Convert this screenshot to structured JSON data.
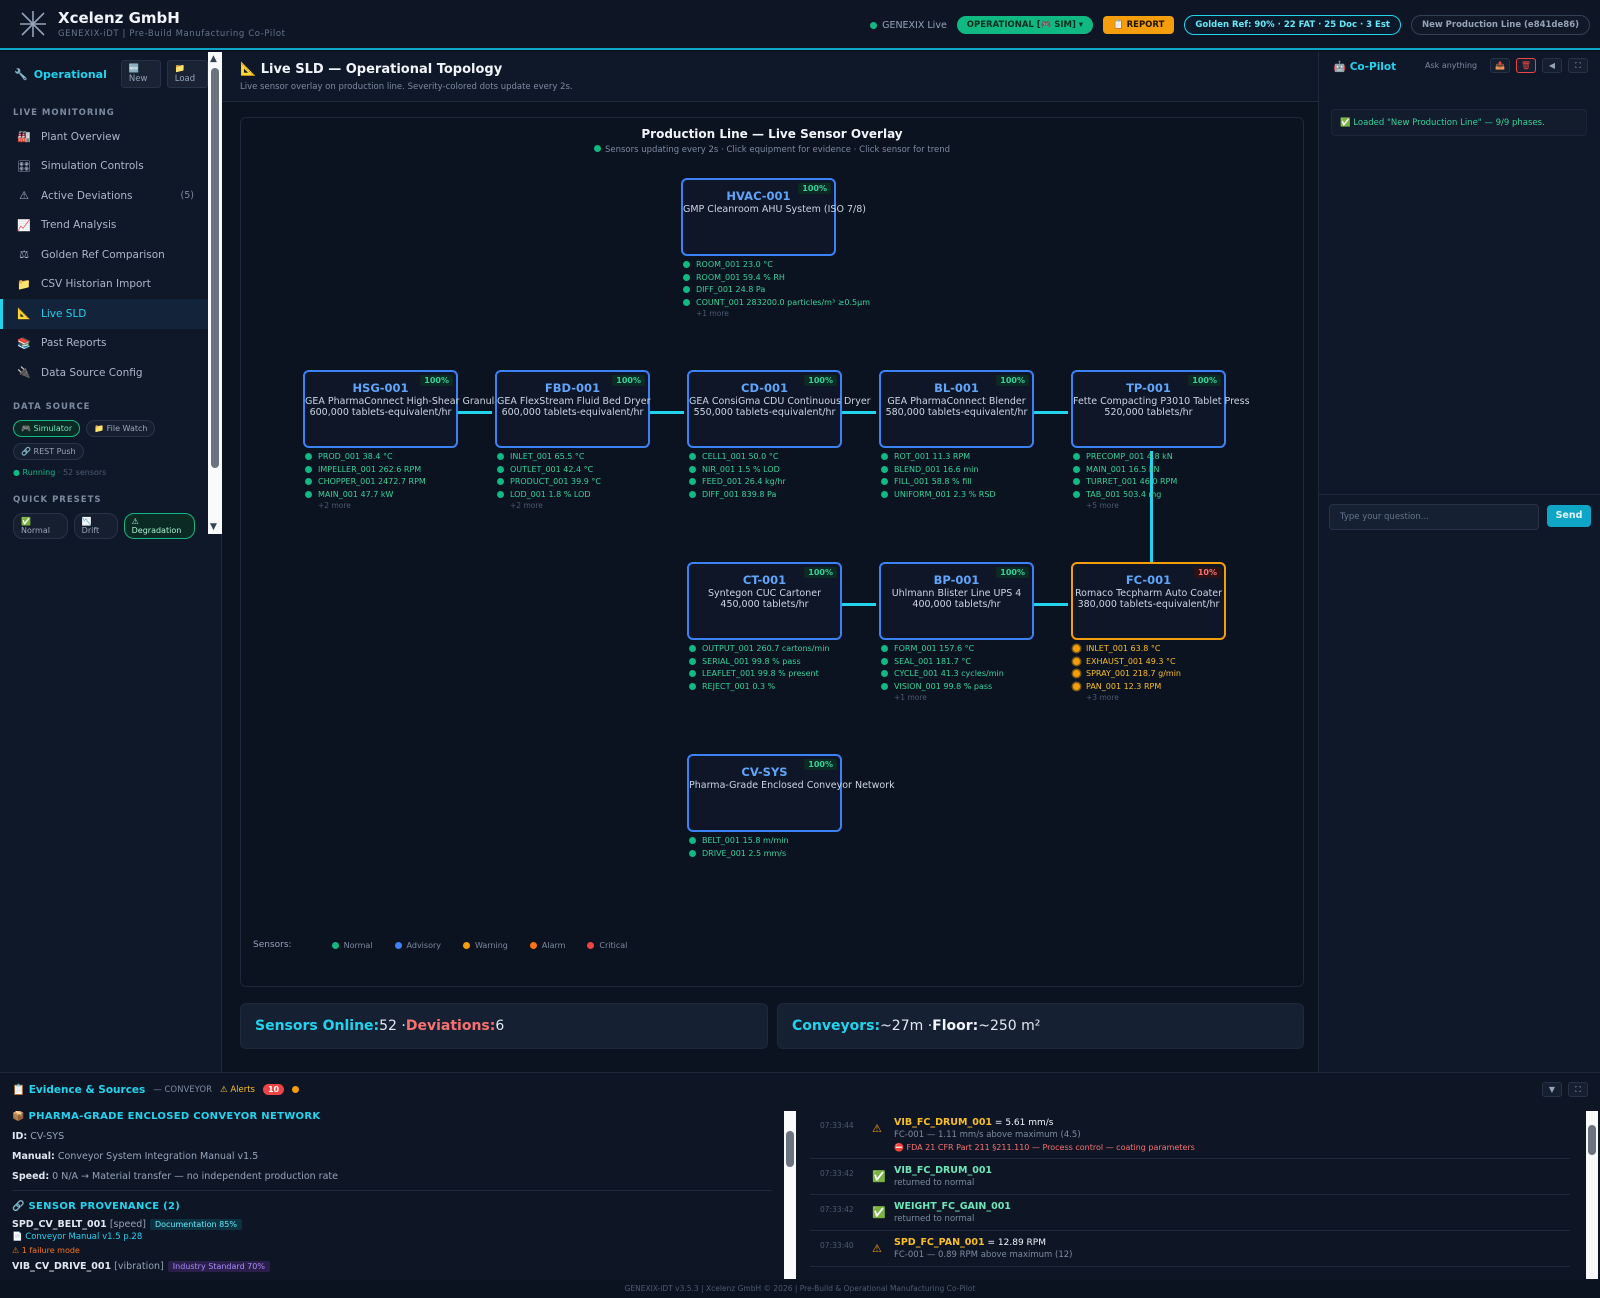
{
  "header": {
    "brand": "Xcelenz GmbH",
    "subtitle": "GENEXIX-iDT | Pre-Build Manufacturing Co-Pilot",
    "live_label": "GENEXIX Live",
    "operational_label": "OPERATIONAL [🎮 SIM] ▾",
    "report_label": "📋 REPORT",
    "golden_ref": "Golden Ref: 90% · 22 FAT · 25 Doc · 3 Est",
    "line_label": "New Production Line (e841de86)"
  },
  "sidebar": {
    "mode": "Operational",
    "new_label": "New",
    "load_label": "Load",
    "live_monitoring_heading": "LIVE MONITORING",
    "items": [
      {
        "label": "Plant Overview",
        "icon": "🏭"
      },
      {
        "label": "Simulation Controls",
        "icon": "🎛"
      },
      {
        "label": "Active Deviations",
        "icon": "⚠",
        "count": "(5)"
      },
      {
        "label": "Trend Analysis",
        "icon": "📈"
      },
      {
        "label": "Golden Ref Comparison",
        "icon": "⚖"
      },
      {
        "label": "CSV Historian Import",
        "icon": "📁"
      },
      {
        "label": "Live SLD",
        "icon": "📐"
      },
      {
        "label": "Past Reports",
        "icon": "📚"
      },
      {
        "label": "Data Source Config",
        "icon": "🔌"
      }
    ],
    "data_source_heading": "DATA SOURCE",
    "sources": [
      "🎮 Simulator",
      "📁 File Watch",
      "🔗 REST Push"
    ],
    "running_label": "● Running",
    "running_detail": " · 52 sensors",
    "presets_heading": "QUICK PRESETS",
    "presets": [
      "✅ Normal",
      "📉 Drift",
      "⚠ Degradation"
    ]
  },
  "main": {
    "title": "📐 Live SLD — Operational Topology",
    "subtitle": "Live sensor overlay on production line. Severity-colored dots update every 2s.",
    "canvas_title": "Production Line — Live Sensor Overlay",
    "canvas_sub": "Sensors updating every 2s · Click equipment for evidence · Click sensor for trend",
    "legend_label": "Sensors:",
    "legend": [
      {
        "label": "Normal",
        "color": "#10b981"
      },
      {
        "label": "Advisory",
        "color": "#3b82f6"
      },
      {
        "label": "Warning",
        "color": "#f59e0b"
      },
      {
        "label": "Alarm",
        "color": "#f97316"
      },
      {
        "label": "Critical",
        "color": "#ef4444"
      }
    ],
    "equipment": [
      {
        "id": "HVAC-001",
        "name": "GMP Cleanroom AHU System (ISO 7/8)",
        "rate": "",
        "pct": "100%",
        "sensors": [
          "ROOM_001 23.0 °C",
          "ROOM_001 59.4 % RH",
          "DIFF_001 24.8 Pa",
          "COUNT_001 283200.0 particles/m³ ≥0.5µm"
        ],
        "more": "+1 more"
      },
      {
        "id": "HSG-001",
        "name": "GEA PharmaConnect High-Shear Granulator",
        "rate": "600,000 tablets-equivalent/hr",
        "pct": "100%",
        "sensors": [
          "PROD_001 38.4 °C",
          "IMPELLER_001 262.6 RPM",
          "CHOPPER_001 2472.7 RPM",
          "MAIN_001 47.7 kW"
        ],
        "more": "+2 more"
      },
      {
        "id": "FBD-001",
        "name": "GEA FlexStream Fluid Bed Dryer",
        "rate": "600,000 tablets-equivalent/hr",
        "pct": "100%",
        "sensors": [
          "INLET_001 65.5 °C",
          "OUTLET_001 42.4 °C",
          "PRODUCT_001 39.9 °C",
          "LOD_001 1.8 % LOD"
        ],
        "more": "+2 more"
      },
      {
        "id": "CD-001",
        "name": "GEA ConsiGma CDU Continuous Dryer",
        "rate": "550,000 tablets-equivalent/hr",
        "pct": "100%",
        "sensors": [
          "CELL1_001 50.0 °C",
          "NIR_001 1.5 % LOD",
          "FEED_001 26.4 kg/hr",
          "DIFF_001 839.8 Pa"
        ],
        "more": ""
      },
      {
        "id": "BL-001",
        "name": "GEA PharmaConnect Blender",
        "rate": "580,000 tablets-equivalent/hr",
        "pct": "100%",
        "sensors": [
          "ROT_001 11.3 RPM",
          "BLEND_001 16.6 min",
          "FILL_001 58.8 % fill",
          "UNIFORM_001 2.3 % RSD"
        ],
        "more": ""
      },
      {
        "id": "TP-001",
        "name": "Fette Compacting P3010 Tablet Press",
        "rate": "520,000 tablets/hr",
        "pct": "100%",
        "sensors": [
          "PRECOMP_001 4.8 kN",
          "MAIN_001 16.5 kN",
          "TURRET_001 46.0 RPM",
          "TAB_001 503.4 mg"
        ],
        "more": "+5 more"
      },
      {
        "id": "CT-001",
        "name": "Syntegon CUC Cartoner",
        "rate": "450,000 tablets/hr",
        "pct": "100%",
        "sensors": [
          "OUTPUT_001 260.7 cartons/min",
          "SERIAL_001 99.8 % pass",
          "LEAFLET_001 99.8 % present",
          "REJECT_001 0.3 %"
        ],
        "more": ""
      },
      {
        "id": "BP-001",
        "name": "Uhlmann Blister Line UPS 4",
        "rate": "400,000 tablets/hr",
        "pct": "100%",
        "sensors": [
          "FORM_001 157.6 °C",
          "SEAL_001 181.7 °C",
          "CYCLE_001 41.3 cycles/min",
          "VISION_001 99.8 % pass"
        ],
        "more": "+1 more"
      },
      {
        "id": "FC-001",
        "name": "Romaco Tecpharm Auto Coater",
        "rate": "380,000 tablets-equivalent/hr",
        "pct": "10%",
        "sensors": [
          "INLET_001 63.8 °C",
          "EXHAUST_001 49.3 °C",
          "SPRAY_001 218.7 g/min",
          "PAN_001 12.3 RPM"
        ],
        "more": "+3 more"
      },
      {
        "id": "CV-SYS",
        "name": "Pharma-Grade Enclosed Conveyor Network",
        "rate": "",
        "pct": "100%",
        "sensors": [
          "BELT_001 15.8 m/min",
          "DRIVE_001 2.5 mm/s"
        ],
        "more": ""
      }
    ],
    "stats": {
      "sensors_label": "Sensors Online:",
      "sensors_value": " 52 · ",
      "deviations_label": "Deviations:",
      "deviations_value": " 6",
      "conveyors_label": "Conveyors:",
      "conveyors_value": " ~27m · ",
      "floor_label": "Floor:",
      "floor_value": " ~250 m²"
    }
  },
  "copilot": {
    "title": "🤖 Co-Pilot",
    "ask": "Ask anything",
    "message": "✅ Loaded \"New Production Line\" — 9/9 phases.",
    "placeholder": "Type your question...",
    "send": "Send"
  },
  "evidence": {
    "title": "📋 Evidence & Sources",
    "context": "— CONVEYOR",
    "alerts_label": "⚠ Alerts",
    "alerts_count": "10",
    "equipment_heading": "📦 PHARMA-GRADE ENCLOSED CONVEYOR NETWORK",
    "id_label": "ID:",
    "id_value": "CV-SYS",
    "manual_label": "Manual:",
    "manual_value": "Conveyor System Integration Manual v1.5",
    "speed_label": "Speed:",
    "speed_value": "0 N/A → Material transfer — no independent production rate",
    "provenance_heading": "🔗 SENSOR PROVENANCE (2)",
    "sensor1": "SPD_CV_BELT_001",
    "sensor1_type": "[speed]",
    "sensor1_badge": "Documentation 85%",
    "sensor1_doc": "📄 Conveyor Manual v1.5 p.28",
    "sensor1_fail": "⚠ 1 failure mode",
    "sensor2": "VIB_CV_DRIVE_001",
    "sensor2_type": "[vibration]",
    "sensor2_badge": "Industry Standard 70%",
    "alerts": [
      {
        "time": "07:33:44",
        "icon": "⚠",
        "name": "VIB_FC_DRUM_001",
        "value": "= 5.61 mm/s",
        "desc": "FC-001 — 1.11 mm/s above maximum (4.5)",
        "reg": "⛔ FDA 21 CFR Part 211 §211.110 — Process control — coating parameters",
        "ok": false
      },
      {
        "time": "07:33:42",
        "icon": "✅",
        "name": "VIB_FC_DRUM_001",
        "value": "",
        "desc": "returned to normal",
        "reg": "",
        "ok": true
      },
      {
        "time": "07:33:42",
        "icon": "✅",
        "name": "WEIGHT_FC_GAIN_001",
        "value": "",
        "desc": "returned to normal",
        "reg": "",
        "ok": true
      },
      {
        "time": "07:33:40",
        "icon": "⚠",
        "name": "SPD_FC_PAN_001",
        "value": "= 12.89 RPM",
        "desc": "FC-001 — 0.89 RPM above maximum (12)",
        "reg": "",
        "ok": false
      }
    ]
  },
  "footer": "GENEXIX-iDT v3.5.3 | Xcelenz GmbH © 2026 | Pre-Build & Operational Manufacturing Co-Pilot"
}
